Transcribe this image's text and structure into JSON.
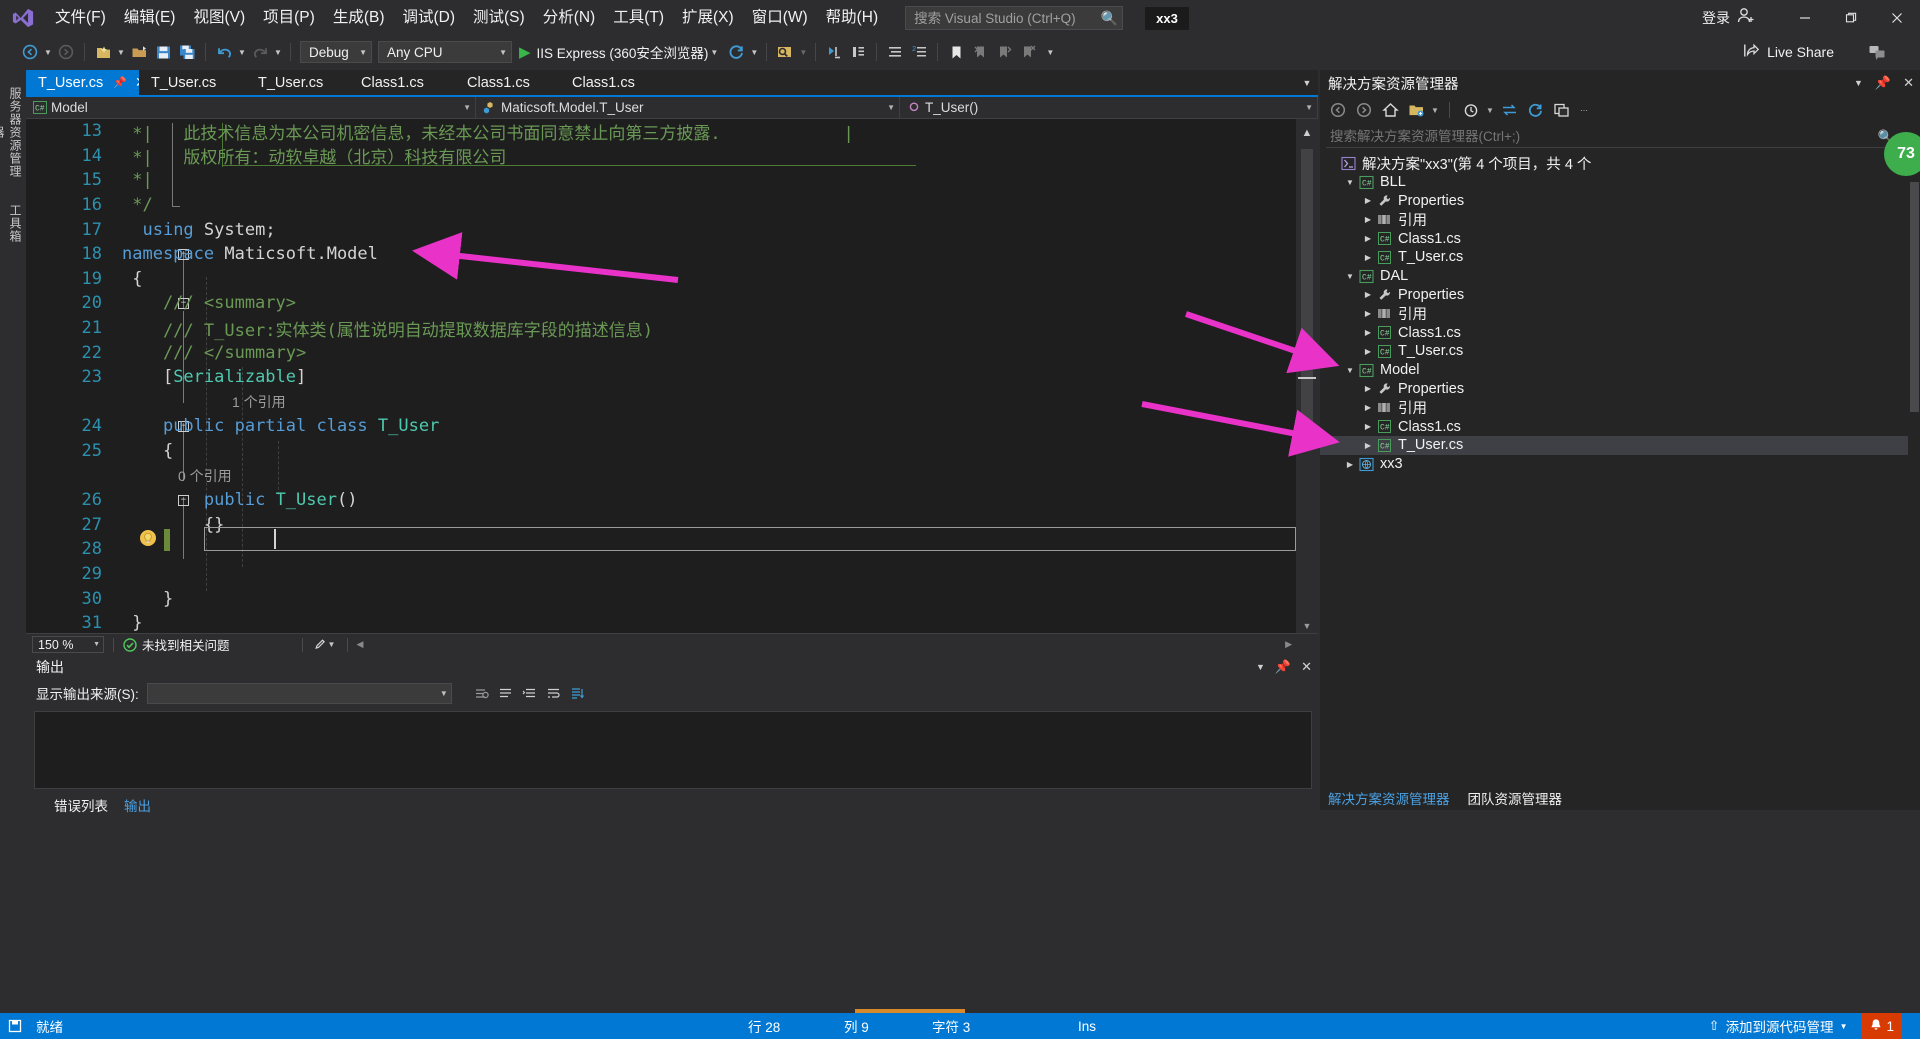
{
  "app": {
    "logo": "visual-studio-logo",
    "solution_chip": "xx3",
    "signin_label": "登录",
    "live_share_label": "Live Share"
  },
  "menu": {
    "items": [
      {
        "label": "文件(F)",
        "accel": "F"
      },
      {
        "label": "编辑(E)",
        "accel": "E"
      },
      {
        "label": "视图(V)",
        "accel": "V"
      },
      {
        "label": "项目(P)",
        "accel": "P"
      },
      {
        "label": "生成(B)",
        "accel": "B"
      },
      {
        "label": "调试(D)",
        "accel": "D"
      },
      {
        "label": "测试(S)",
        "accel": "S"
      },
      {
        "label": "分析(N)",
        "accel": "N"
      },
      {
        "label": "工具(T)",
        "accel": "T"
      },
      {
        "label": "扩展(X)",
        "accel": "X"
      },
      {
        "label": "窗口(W)",
        "accel": "W"
      },
      {
        "label": "帮助(H)",
        "accel": "H"
      }
    ]
  },
  "search": {
    "placeholder": "搜索 Visual Studio (Ctrl+Q)",
    "value": "",
    "icon": "search-icon"
  },
  "toolbar": {
    "config": "Debug",
    "platform": "Any CPU",
    "run_target": "IIS Express (360安全浏览器)",
    "run_icon": "play-triangle-icon"
  },
  "vertical_tabs": {
    "server_explorer": "服务器资源管理器",
    "toolbox": "工具箱"
  },
  "editor_tabs": {
    "items": [
      {
        "label": "T_User.cs",
        "active": true,
        "pinned": true,
        "closable": true
      },
      {
        "label": "T_User.cs",
        "active": false
      },
      {
        "label": "T_User.cs",
        "active": false
      },
      {
        "label": "Class1.cs",
        "active": false
      },
      {
        "label": "Class1.cs",
        "active": false
      },
      {
        "label": "Class1.cs",
        "active": false
      }
    ]
  },
  "navbar": {
    "project": "Model",
    "type": "Maticsoft.Model.T_User",
    "member": "T_User()"
  },
  "code": {
    "lines": [
      {
        "num": "13",
        "segments": [
          {
            "t": " *|   此技术信息为本公司机密信息，未经本公司书面同意禁止向第三方披露.            |",
            "c": "cmt"
          }
        ]
      },
      {
        "num": "14",
        "segments": [
          {
            "t": " *|   版权所有：动软卓越（北京）科技有限公司",
            "c": "cmt"
          }
        ]
      },
      {
        "num": "15",
        "segments": [
          {
            "t": " *|",
            "c": "cmt"
          }
        ]
      },
      {
        "num": "16",
        "segments": [
          {
            "t": " */",
            "c": "cmt"
          }
        ]
      },
      {
        "num": "17",
        "segments": [
          {
            "t": "  ",
            "c": "plain"
          },
          {
            "t": "using",
            "c": "kw"
          },
          {
            "t": " System;",
            "c": "plain"
          }
        ]
      },
      {
        "num": "18",
        "fold": true,
        "segments": [
          {
            "t": "namespace",
            "c": "kw"
          },
          {
            "t": " Maticsoft.Model",
            "c": "plain"
          }
        ]
      },
      {
        "num": "19",
        "segments": [
          {
            "t": " {",
            "c": "plain"
          }
        ]
      },
      {
        "num": "20",
        "fold": true,
        "segments": [
          {
            "t": "    /// <summary>",
            "c": "cmt"
          }
        ]
      },
      {
        "num": "21",
        "segments": [
          {
            "t": "    /// T_User:实体类(属性说明自动提取数据库字段的描述信息)",
            "c": "cmt"
          }
        ]
      },
      {
        "num": "22",
        "segments": [
          {
            "t": "    /// </summary>",
            "c": "cmt"
          }
        ]
      },
      {
        "num": "23",
        "segments": [
          {
            "t": "    [",
            "c": "plain"
          },
          {
            "t": "Serializable",
            "c": "type"
          },
          {
            "t": "]",
            "c": "plain"
          }
        ]
      },
      {
        "num": "",
        "lens": "1 个引用"
      },
      {
        "num": "24",
        "fold": true,
        "segments": [
          {
            "t": "    ",
            "c": "plain"
          },
          {
            "t": "public partial class",
            "c": "kw"
          },
          {
            "t": " ",
            "c": "plain"
          },
          {
            "t": "T_User",
            "c": "type"
          }
        ]
      },
      {
        "num": "25",
        "segments": [
          {
            "t": "    {",
            "c": "plain"
          }
        ]
      },
      {
        "num": "",
        "lens": "0 个引用",
        "lens_indent": 56
      },
      {
        "num": "26",
        "fold": true,
        "segments": [
          {
            "t": "        ",
            "c": "plain"
          },
          {
            "t": "public",
            "c": "kw"
          },
          {
            "t": " ",
            "c": "plain"
          },
          {
            "t": "T_User",
            "c": "type"
          },
          {
            "t": "()",
            "c": "plain"
          }
        ]
      },
      {
        "num": "27",
        "segments": [
          {
            "t": "        {}",
            "c": "plain"
          }
        ]
      },
      {
        "num": "28",
        "current": true,
        "segments": [
          {
            "t": "        ",
            "c": "plain"
          }
        ]
      },
      {
        "num": "29",
        "segments": [
          {
            "t": "",
            "c": "plain"
          }
        ]
      },
      {
        "num": "30",
        "segments": [
          {
            "t": "    }",
            "c": "plain"
          }
        ]
      },
      {
        "num": "31",
        "segments": [
          {
            "t": " }",
            "c": "plain"
          }
        ]
      }
    ]
  },
  "editor_status": {
    "zoom": "150 %",
    "issues": "未找到相关问题",
    "issues_icon": "check-circle-icon",
    "brush_icon": "brush-icon"
  },
  "output": {
    "title": "输出",
    "source_label": "显示输出来源(S):",
    "source_value": "",
    "body_text": "",
    "tabs": [
      {
        "label": "错误列表",
        "active": false
      },
      {
        "label": "输出",
        "active": true
      }
    ]
  },
  "solution_explorer": {
    "title": "解决方案资源管理器",
    "search_placeholder": "搜索解决方案资源管理器(Ctrl+;)",
    "search_value": "",
    "badge_count": "73",
    "toolbar_icons": [
      "back-icon",
      "forward-icon",
      "home-icon",
      "solution-folder-icon",
      "pending-changes-icon",
      "sync-icon",
      "refresh-icon",
      "collapse-all-icon",
      "more-icon"
    ],
    "tree": [
      {
        "label": "解决方案\"xx3\"(第 4 个项目，共 4 个",
        "depth": 0,
        "icon": "solution-icon",
        "arrow": "",
        "selected": false
      },
      {
        "label": "BLL",
        "depth": 1,
        "icon": "csharp-project-icon",
        "arrow": "expanded",
        "selected": false
      },
      {
        "label": "Properties",
        "depth": 2,
        "icon": "wrench-icon",
        "arrow": "collapsed",
        "selected": false
      },
      {
        "label": "引用",
        "depth": 2,
        "icon": "references-icon",
        "arrow": "collapsed",
        "selected": false
      },
      {
        "label": "Class1.cs",
        "depth": 2,
        "icon": "csharp-file-icon",
        "arrow": "collapsed",
        "selected": false
      },
      {
        "label": "T_User.cs",
        "depth": 2,
        "icon": "csharp-file-icon",
        "arrow": "collapsed",
        "selected": false
      },
      {
        "label": "DAL",
        "depth": 1,
        "icon": "csharp-project-icon",
        "arrow": "expanded",
        "selected": false
      },
      {
        "label": "Properties",
        "depth": 2,
        "icon": "wrench-icon",
        "arrow": "collapsed",
        "selected": false
      },
      {
        "label": "引用",
        "depth": 2,
        "icon": "references-icon",
        "arrow": "collapsed",
        "selected": false
      },
      {
        "label": "Class1.cs",
        "depth": 2,
        "icon": "csharp-file-icon",
        "arrow": "collapsed",
        "selected": false
      },
      {
        "label": "T_User.cs",
        "depth": 2,
        "icon": "csharp-file-icon",
        "arrow": "collapsed",
        "selected": false
      },
      {
        "label": "Model",
        "depth": 1,
        "icon": "csharp-project-icon",
        "arrow": "expanded",
        "selected": false
      },
      {
        "label": "Properties",
        "depth": 2,
        "icon": "wrench-icon",
        "arrow": "collapsed",
        "selected": false
      },
      {
        "label": "引用",
        "depth": 2,
        "icon": "references-icon",
        "arrow": "collapsed",
        "selected": false
      },
      {
        "label": "Class1.cs",
        "depth": 2,
        "icon": "csharp-file-icon",
        "arrow": "collapsed",
        "selected": false
      },
      {
        "label": "T_User.cs",
        "depth": 2,
        "icon": "csharp-file-icon",
        "arrow": "collapsed",
        "selected": true
      },
      {
        "label": "xx3",
        "depth": 1,
        "icon": "web-project-icon",
        "arrow": "collapsed",
        "selected": false
      }
    ],
    "footer": [
      {
        "label": "解决方案资源管理器",
        "active": true
      },
      {
        "label": "团队资源管理器",
        "active": false
      }
    ]
  },
  "statusbar": {
    "state": "就绪",
    "line_label": "行 28",
    "col_label": "列 9",
    "char_label": "字符 3",
    "ins_label": "Ins",
    "source_control": "添加到源代码管理",
    "notification_count": "1",
    "accent_color": "#0078d4",
    "alert_color": "#d83b01"
  },
  "annotations": {
    "arrow_color": "#e832c8",
    "arrows": 3
  }
}
